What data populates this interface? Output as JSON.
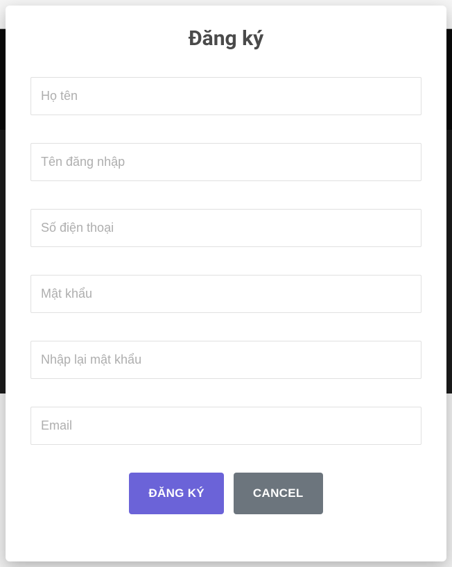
{
  "modal": {
    "title": "Đăng ký",
    "fields": {
      "fullname": {
        "placeholder": "Họ tên",
        "value": ""
      },
      "username": {
        "placeholder": "Tên đăng nhập",
        "value": ""
      },
      "phone": {
        "placeholder": "Số điện thoại",
        "value": ""
      },
      "password": {
        "placeholder": "Mật khẩu",
        "value": ""
      },
      "password_confirm": {
        "placeholder": "Nhập lại mật khẩu",
        "value": ""
      },
      "email": {
        "placeholder": "Email",
        "value": ""
      }
    },
    "buttons": {
      "submit": "ĐĂNG KÝ",
      "cancel": "CANCEL"
    }
  }
}
